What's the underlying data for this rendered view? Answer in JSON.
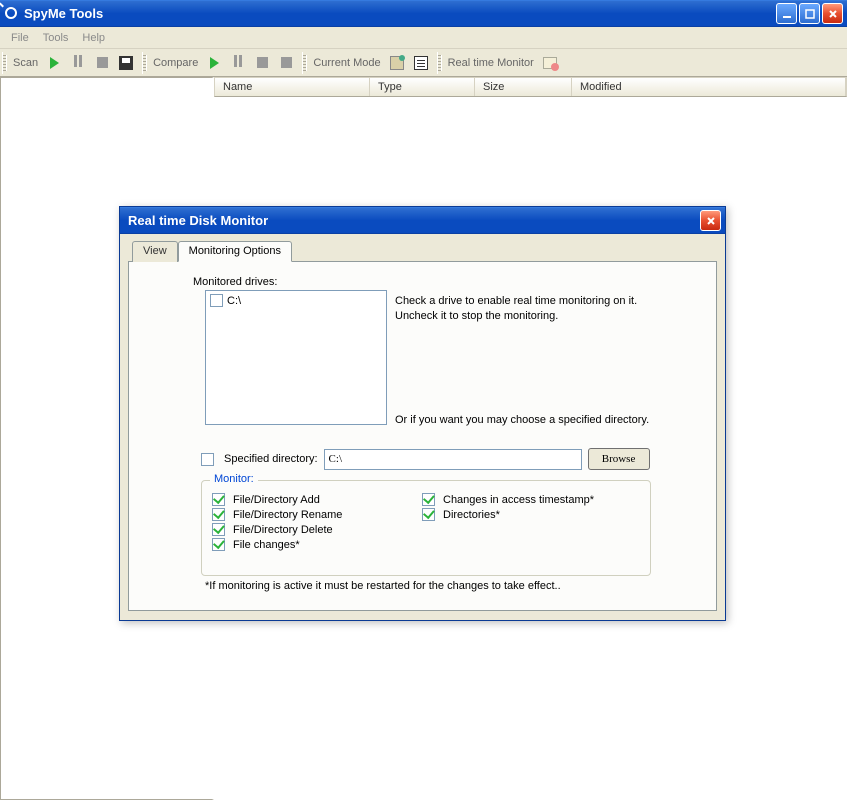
{
  "window": {
    "title": "SpyMe Tools"
  },
  "menu": {
    "file": "File",
    "tools": "Tools",
    "help": "Help"
  },
  "toolbar": {
    "scan": "Scan",
    "compare": "Compare",
    "currentMode": "Current Mode",
    "rtMonitor": "Real time Monitor"
  },
  "columns": {
    "name": "Name",
    "type": "Type",
    "size": "Size",
    "modified": "Modified"
  },
  "dialog": {
    "title": "Real time Disk Monitor",
    "tabView": "View",
    "tabOptions": "Monitoring Options",
    "monitoredDrives": "Monitored drives:",
    "drives": [
      {
        "label": "C:\\",
        "checked": false
      }
    ],
    "help1a": "Check a drive to enable real time monitoring on it.",
    "help1b": "Uncheck it to stop the monitoring.",
    "help2": "Or if you want you may choose a specified directory.",
    "specDirChecked": false,
    "specDirLabel": "Specified directory:",
    "specDirValue": "C:\\",
    "browse": "Browse",
    "monitorLegend": "Monitor:",
    "monAdd": "File/Directory Add",
    "monRename": "File/Directory Rename",
    "monDelete": "File/Directory Delete",
    "monFileChanges": "File changes*",
    "monAccess": "Changes in access timestamp*",
    "monDirs": "Directories*",
    "footnote": "*If monitoring is active it must be restarted for the changes to take effect.."
  }
}
